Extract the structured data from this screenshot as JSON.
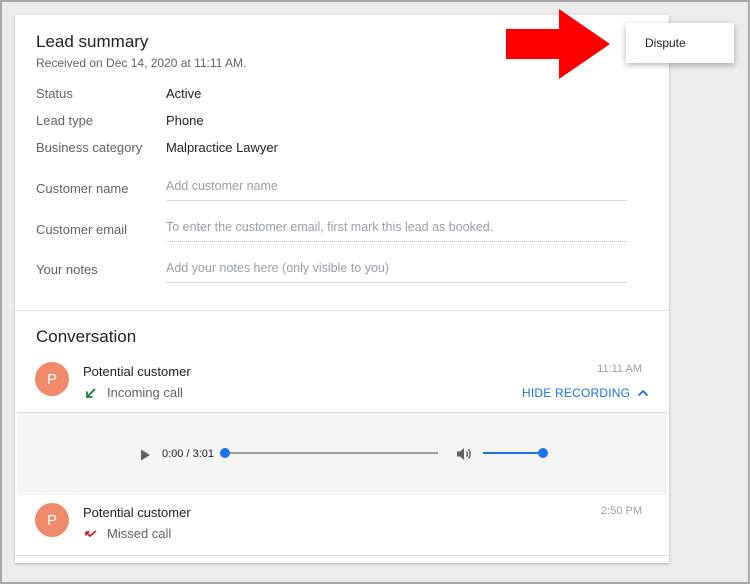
{
  "lead_summary": {
    "title": "Lead summary",
    "received": "Received on Dec 14, 2020 at 11:11 AM.",
    "rows": [
      {
        "label": "Status",
        "value": "Active"
      },
      {
        "label": "Lead type",
        "value": "Phone"
      },
      {
        "label": "Business category",
        "value": "Malpractice Lawyer"
      }
    ],
    "fields": [
      {
        "label": "Customer name",
        "placeholder": "Add customer name"
      },
      {
        "label": "Customer email",
        "placeholder": "To enter the customer email, first mark this lead as booked."
      },
      {
        "label": "Your notes",
        "placeholder": "Add your notes here (only visible to you)"
      }
    ]
  },
  "conversation": {
    "title": "Conversation",
    "calls": [
      {
        "avatar": "P",
        "caller": "Potential customer",
        "type": "Incoming call",
        "time": "11:11 AM",
        "icon": "incoming-call-icon",
        "icon_color": "#188038"
      },
      {
        "avatar": "P",
        "caller": "Potential customer",
        "type": "Missed call",
        "time": "2:50 PM",
        "icon": "missed-call-icon",
        "icon_color": "#c5221f"
      }
    ],
    "hide_recording": "HIDE RECORDING",
    "player": {
      "time": "0:00 / 3:01",
      "progress": 0,
      "volume": 1.0
    }
  },
  "menu": {
    "dispute": "Dispute"
  },
  "colors": {
    "accent": "#1a73e8",
    "avatar": "#ef8a6a",
    "arrow": "#ff0000"
  }
}
